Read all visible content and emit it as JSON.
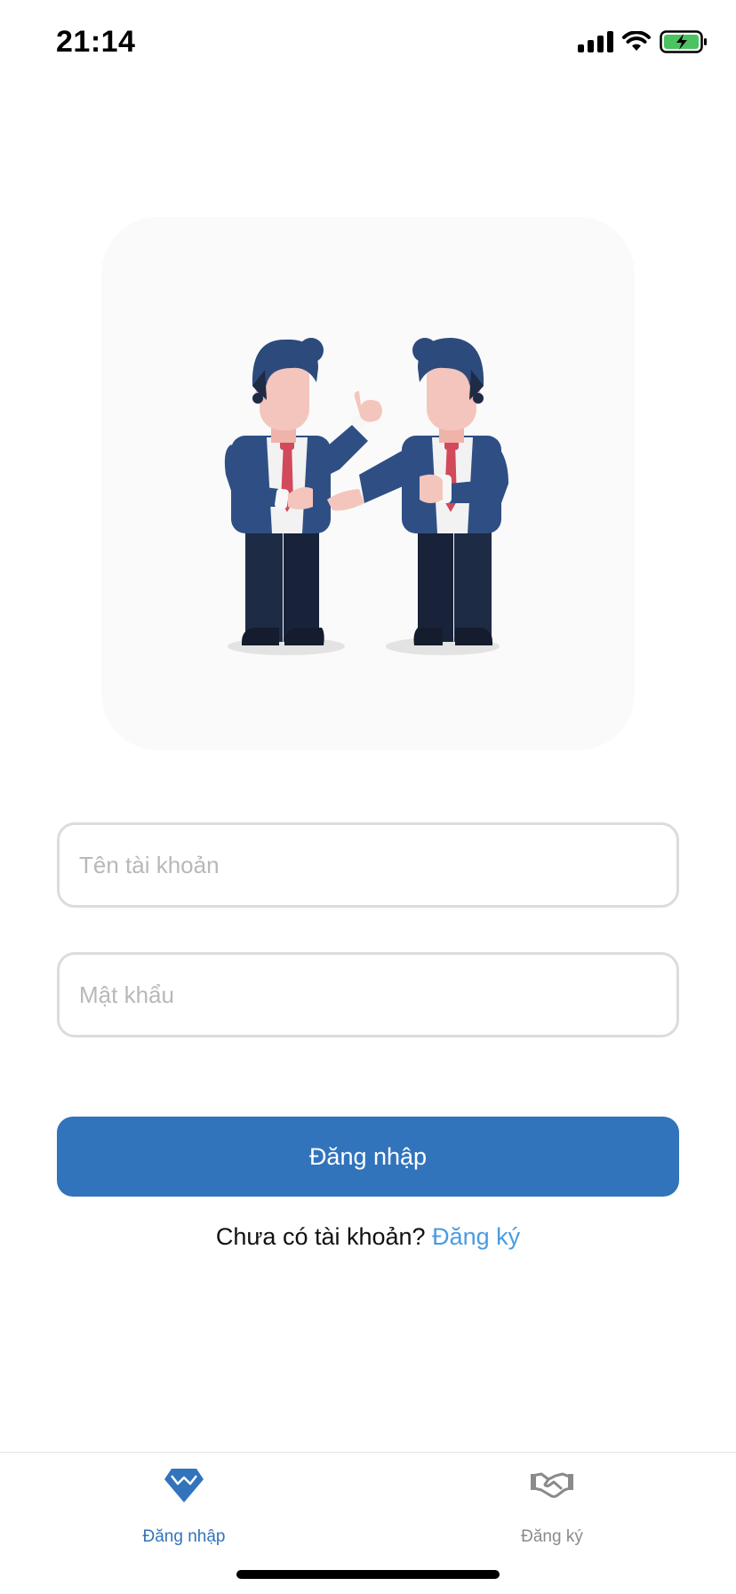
{
  "status_bar": {
    "time": "21:14",
    "icons": [
      "cellular-signal-icon",
      "wifi-icon",
      "battery-charging-icon"
    ]
  },
  "hero": {
    "illustration": "two-businessmen-handshake-illustration"
  },
  "form": {
    "username": {
      "value": "",
      "placeholder": "Tên tài khoản"
    },
    "password": {
      "value": "",
      "placeholder": "Mật khẩu"
    },
    "submit_label": "Đăng nhập",
    "signup_prompt": "Chưa có tài khoản?",
    "signup_link": "Đăng ký"
  },
  "tab_bar": {
    "tabs": [
      {
        "label": "Đăng nhập",
        "icon": "diamond-icon",
        "active": true
      },
      {
        "label": "Đăng ký",
        "icon": "handshake-icon",
        "active": false
      }
    ]
  },
  "colors": {
    "primary": "#3274bb",
    "link": "#4a9be0",
    "inactive_tab": "#8a8a8a",
    "input_border": "#dcdcdc"
  }
}
